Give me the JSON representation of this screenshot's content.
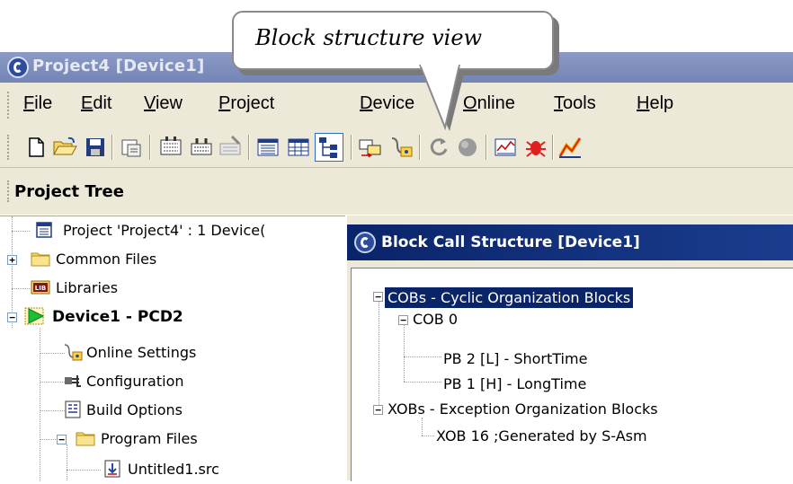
{
  "window": {
    "title": "Project4 [Device1]"
  },
  "callout": {
    "text": "Block structure view"
  },
  "menu": {
    "items": [
      {
        "label": "File",
        "u": "F",
        "rest": "ile"
      },
      {
        "label": "Edit",
        "u": "E",
        "rest": "dit"
      },
      {
        "label": "View",
        "u": "V",
        "rest": "iew"
      },
      {
        "label": "Project",
        "u": "P",
        "rest": "roject"
      },
      {
        "label": "Device",
        "u": "D",
        "rest": "evice"
      },
      {
        "label": "Online",
        "u": "O",
        "rest": "nline"
      },
      {
        "label": "Tools",
        "u": "T",
        "rest": "ools"
      },
      {
        "label": "Help",
        "u": "H",
        "rest": "elp"
      }
    ]
  },
  "toolbar": {
    "buttons": [
      "new-file-icon",
      "open-folder-icon",
      "save-icon",
      "properties-icon",
      "build-icon",
      "build-all-icon",
      "clean-icon",
      "list-view-icon",
      "table-view-icon",
      "block-structure-icon",
      "download-icon",
      "online-settings-icon",
      "go-online-icon",
      "stop-icon",
      "watch-window-icon",
      "debug-icon",
      "chart-icon"
    ],
    "accent": "#e8b400"
  },
  "project_tree": {
    "header": "Project Tree",
    "items": [
      {
        "label": "Project 'Project4' : 1 Device(",
        "icon": "project-icon"
      },
      {
        "label": "Common Files",
        "icon": "folder-icon"
      },
      {
        "label": "Libraries",
        "icon": "library-icon"
      },
      {
        "label": "Device1 - PCD2",
        "icon": "device-icon"
      },
      {
        "label": "Online Settings",
        "icon": "online-settings-icon"
      },
      {
        "label": "Configuration",
        "icon": "configuration-icon"
      },
      {
        "label": "Build Options",
        "icon": "build-options-icon"
      },
      {
        "label": "Program Files",
        "icon": "folder-icon"
      },
      {
        "label": "Untitled1.src",
        "icon": "source-file-icon"
      }
    ]
  },
  "block_call_structure": {
    "title": "Block Call Structure [Device1]",
    "items": [
      {
        "label": "COBs - Cyclic Organization Blocks",
        "selected": true
      },
      {
        "label": "COB 0"
      },
      {
        "label": "PB 2 [L] - ShortTime"
      },
      {
        "label": "PB 1 [H] - LongTime"
      },
      {
        "label": "XOBs - Exception Organization Blocks"
      },
      {
        "label": "XOB 16  ;Generated by S-Asm"
      }
    ]
  }
}
